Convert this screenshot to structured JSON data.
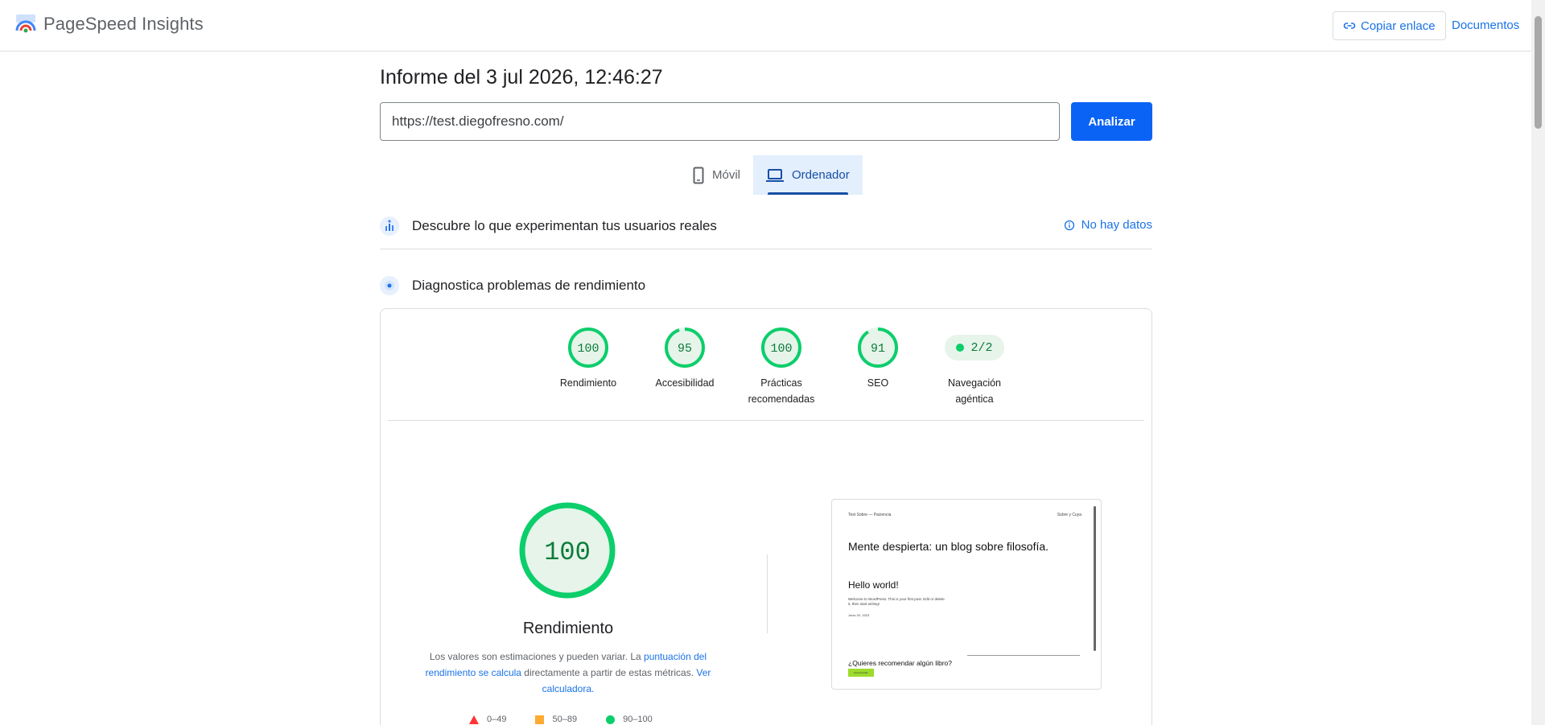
{
  "header": {
    "app_name": "PageSpeed Insights",
    "copy_link_label": "Copiar enlace",
    "docs_label": "Documentos"
  },
  "report": {
    "title": "Informe del 3 jul 2026, 12:46:27",
    "url_value": "https://test.diegofresno.com/",
    "analyze_label": "Analizar"
  },
  "device_tabs": [
    {
      "label": "Móvil",
      "active": false
    },
    {
      "label": "Ordenador",
      "active": true
    }
  ],
  "crux": {
    "title": "Descubre lo que experimentan tus usuarios reales",
    "no_data_label": "No hay datos"
  },
  "lighthouse": {
    "title": "Diagnostica problemas de rendimiento"
  },
  "scores": [
    {
      "score": "100",
      "value": 100,
      "label": "Rendimiento"
    },
    {
      "score": "95",
      "value": 95,
      "label": "Accesibilidad"
    },
    {
      "score": "100",
      "value": 100,
      "label": "Prácticas recomendadas"
    },
    {
      "score": "91",
      "value": 91,
      "label": "SEO"
    }
  ],
  "agentic": {
    "value": "2/2",
    "label": "Navegación agéntica"
  },
  "performance": {
    "score": "100",
    "title": "Rendimiento",
    "desc_part1": "Los valores son estimaciones y pueden variar. La ",
    "desc_link1": "puntuación del rendimiento se calcula",
    "desc_part2": " directamente a partir de estas métricas. ",
    "desc_link2": "Ver calculadora."
  },
  "legend": {
    "low": "0–49",
    "mid": "50–89",
    "high": "90–100"
  },
  "screenshot": {
    "site_nav_left": "Test Sobre — Paciencia",
    "site_nav_right": "Sobre y Cuya",
    "heading": "Mente despierta: un blog sobre filosofía.",
    "post_title": "Hello world!",
    "post_text": "Welcome to WordPress. This is your first post. Edit or delete it, then start writing!",
    "post_date": "Junio 20, 2023",
    "question": "¿Quieres recomendar algún libro?",
    "button": "Recomendar"
  },
  "colors": {
    "pass": "#0cce6b",
    "pass_text": "#0c7c3a",
    "pass_bg": "#e6f4ea",
    "link": "#1a73e8",
    "primary": "#0b63f5"
  }
}
